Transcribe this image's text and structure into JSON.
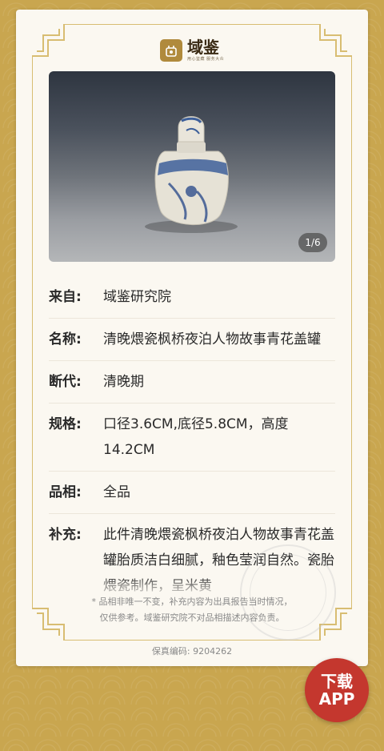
{
  "brand": {
    "name": "域鉴",
    "tagline": "用心鉴藏 服务大众"
  },
  "gallery": {
    "counter": "1/6"
  },
  "details": [
    {
      "label": "来自:",
      "value": "域鉴研究院"
    },
    {
      "label": "名称:",
      "value": "清晚煨瓷枫桥夜泊人物故事青花盖罐"
    },
    {
      "label": "断代:",
      "value": "清晚期"
    },
    {
      "label": "规格:",
      "value": "口径3.6CM,底径5.8CM，高度14.2CM"
    },
    {
      "label": "品相:",
      "value": "全品"
    },
    {
      "label": "补充:",
      "value": "此件清晚煨瓷枫桥夜泊人物故事青花盖罐胎质洁白细腻，釉色莹润自然。瓷胎煨瓷制作，呈米黄"
    }
  ],
  "disclaimer": {
    "line1": "* 品相非唯一不变，补充内容为出具报告当时情况，",
    "line2": "仅供参考。域鉴研究院不对品相描述内容负责。"
  },
  "verification": {
    "label": "保真编码:",
    "code": "9204262"
  },
  "download": {
    "line1": "下载",
    "line2": "APP"
  },
  "colors": {
    "background": "#c9a64f",
    "card": "#fbf8f1",
    "accent_red": "#c4372e",
    "frame_gold": "#d4b25c"
  }
}
